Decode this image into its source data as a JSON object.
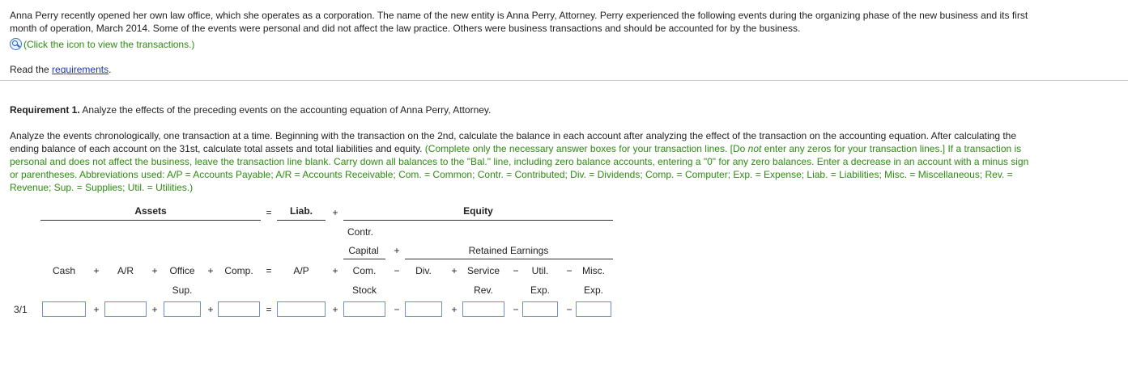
{
  "intro": {
    "line1": "Anna Perry recently opened her own law office, which she operates as a corporation. The name of the new entity is Anna Perry, Attorney. Perry experienced the following events during the organizing phase of the new business and its first",
    "line2": "month of operation, March 2014. Some of the events were personal and did not affect the law practice. Others were business transactions and should be accounted for by the business.",
    "view_transactions": "(Click the icon to view the transactions.)",
    "read_prefix": "Read the ",
    "requirements_link": "requirements",
    "read_suffix": "."
  },
  "requirement": {
    "title": "Requirement 1.",
    "text": " Analyze the effects of the preceding events on the accounting equation of Anna Perry, Attorney.",
    "para_black1": "Analyze the events chronologically, one transaction at a time. Beginning with the transaction on the 2nd, calculate the balance in each account after analyzing the effect of the transaction on the accounting equation. After calculating the",
    "para_black2": "ending balance of each account on the 31st, calculate total assets and total liabilities and equity. ",
    "para_green2": "(Complete only the necessary answer boxes for your transaction lines. [Do ",
    "para_green2_italic": "not",
    "para_green2b": " enter any zeros for your transaction lines.] If a transaction is",
    "para_green3": "personal and does not affect the business, leave the transaction line blank. Carry down all balances to the \"Bal.\" line, including zero balance accounts, entering a \"0\" for any zero balances. Enter a decrease in an account with a minus sign",
    "para_green4": "or parentheses. Abbreviations used: A/P = Accounts Payable; A/R = Accounts Receivable; Com. = Common; Contr. = Contributed; Div. = Dividends; Comp. = Computer; Exp. = Expense; Liab. = Liabilities; Misc. = Miscellaneous; Rev. =",
    "para_green5": "Revenue; Sup. = Supplies; Util. = Utilities.)"
  },
  "table": {
    "assets": "Assets",
    "eq": "=",
    "liab": "Liab.",
    "plus": "+",
    "minus": "−",
    "equity": "Equity",
    "contr": "Contr.",
    "capital": "Capital",
    "retained": "Retained Earnings",
    "cols": {
      "cash": "Cash",
      "ar": "A/R",
      "office": "Office",
      "comp": "Comp.",
      "ap": "A/P",
      "com": "Com.",
      "div": "Div.",
      "service": "Service",
      "util": "Util.",
      "misc": "Misc."
    },
    "sub": {
      "sup": "Sup.",
      "stock": "Stock",
      "rev": "Rev.",
      "exp1": "Exp.",
      "exp2": "Exp."
    },
    "row_label": "3/1",
    "row_values": {
      "cash": "",
      "ar": "",
      "office": "",
      "comp": "",
      "ap": "",
      "com": "",
      "div": "",
      "service": "",
      "util": "",
      "misc": ""
    }
  }
}
